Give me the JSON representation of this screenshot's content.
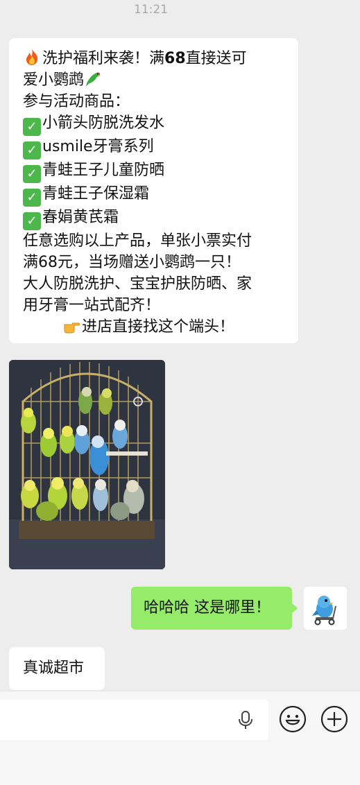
{
  "timestamp": "11:21",
  "message1": {
    "line1": "洗护福利来袭！满",
    "line1_num": "68",
    "line1_tail": "直接送可",
    "line2": "爱小鹦鹉",
    "line3": "参与活动商品：",
    "items": [
      "小箭头防脱洗发水",
      "usmile牙膏系列",
      "青蛙王子儿童防晒",
      "青蛙王子保湿霜",
      "春娟黄芪霜"
    ],
    "line9": "任意选购以上产品，单张小票实付",
    "line10": "满68元，当场赠送小鹦鹉一只！",
    "line11": "大人防脱洗护、宝宝护肤防晒、家",
    "line12": "用牙膏一站式配齐！",
    "line13": "进店直接找这个端头！"
  },
  "message2_image": "budgerigars-in-cage-photo",
  "reply": "哈哈哈 这是哪里！",
  "message3": "真诚超市",
  "icons": [
    "fire-icon",
    "parrot-icon",
    "check-icon",
    "pointing-hand-icon",
    "mic-icon",
    "emoji-icon",
    "plus-icon"
  ],
  "colors": {
    "bubble_sent": "#95ec69",
    "bubble_received": "#ffffff",
    "background": "#ededed"
  }
}
